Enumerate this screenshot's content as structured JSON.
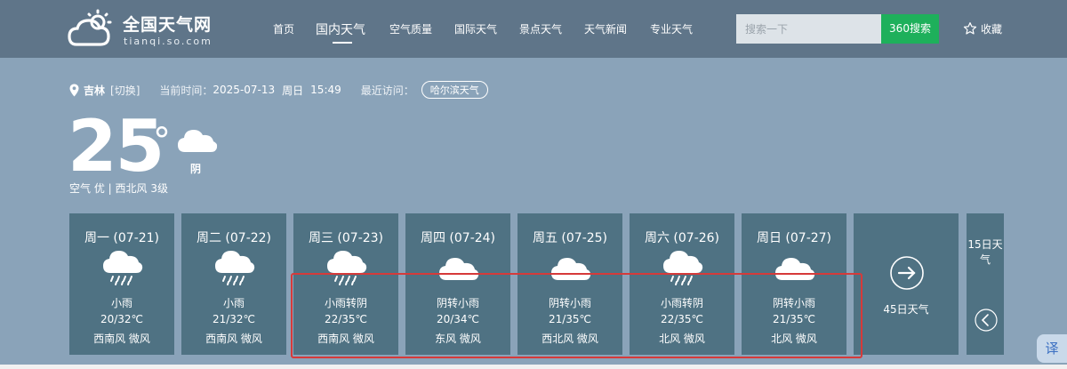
{
  "logo": {
    "title": "全国天气网",
    "subtitle": "tianqi.so.com"
  },
  "nav": {
    "items": [
      "首页",
      "国内天气",
      "空气质量",
      "国际天气",
      "景点天气",
      "天气新闻",
      "专业天气"
    ],
    "active_index": 1
  },
  "search": {
    "placeholder": "搜索一下",
    "button_label": "360搜索"
  },
  "favorite": {
    "label": "收藏",
    "icon": "star-icon"
  },
  "location": {
    "icon": "location-pin-icon",
    "city": "吉林",
    "switch_label": "[切换]"
  },
  "datetime": {
    "label": "当前时间：",
    "date": "2025-07-13",
    "weekday": "周日",
    "time": "15:49"
  },
  "recent": {
    "label": "最近访问：",
    "city": "哈尔滨天气"
  },
  "current": {
    "temperature": "25",
    "degree_symbol": "°",
    "weather": "阴",
    "icon": "cloudy-icon",
    "air_quality": "空气 优",
    "separator": "|",
    "wind": "西北风 3级"
  },
  "forecast": [
    {
      "day": "周一 (07-21)",
      "icon": "rain-icon",
      "desc": "小雨",
      "temp": "20/32℃",
      "wind": "西南风 微风"
    },
    {
      "day": "周二 (07-22)",
      "icon": "rain-icon",
      "desc": "小雨",
      "temp": "21/32℃",
      "wind": "西南风 微风"
    },
    {
      "day": "周三 (07-23)",
      "icon": "rain-icon",
      "desc": "小雨转阴",
      "temp": "22/35℃",
      "wind": "西南风 微风"
    },
    {
      "day": "周四 (07-24)",
      "icon": "cloudy-icon",
      "desc": "阴转小雨",
      "temp": "20/34℃",
      "wind": "东风 微风"
    },
    {
      "day": "周五 (07-25)",
      "icon": "cloudy-icon",
      "desc": "阴转小雨",
      "temp": "21/35℃",
      "wind": "西北风 微风"
    },
    {
      "day": "周六 (07-26)",
      "icon": "rain-icon",
      "desc": "小雨转阴",
      "temp": "22/35℃",
      "wind": "北风 微风"
    },
    {
      "day": "周日 (07-27)",
      "icon": "cloudy-icon",
      "desc": "阴转小雨",
      "temp": "21/35℃",
      "wind": "北风 微风"
    }
  ],
  "more": {
    "label_45": "45日天气",
    "label_15": "15日天气"
  },
  "translate": {
    "label": "译"
  },
  "colors": {
    "header": "#5f7589",
    "background": "#8aa3b9",
    "card": "#4f7283",
    "search_button": "#1eb05b",
    "highlight": "#d63a3a"
  }
}
